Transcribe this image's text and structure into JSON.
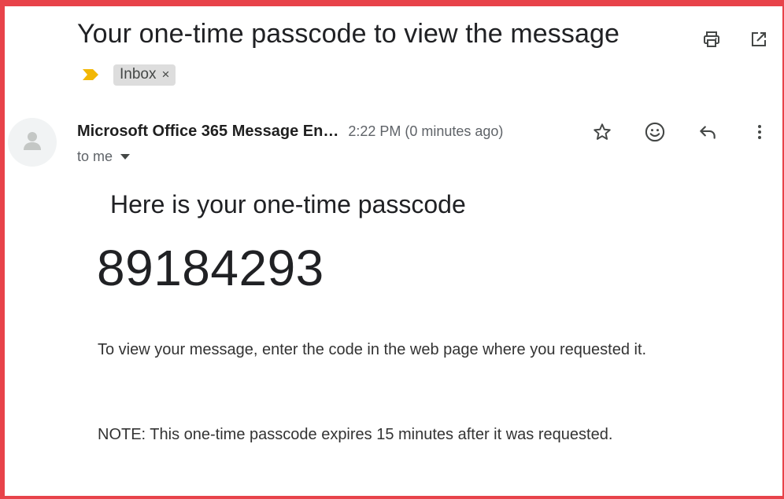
{
  "email": {
    "subject": "Your one-time passcode to view the message",
    "label": "Inbox",
    "label_remove": "×",
    "sender_name": "Microsoft Office 365 Message En…",
    "timestamp": "2:22 PM (0 minutes ago)",
    "recipient": "to me",
    "body": {
      "heading": "Here is your one-time passcode",
      "passcode": "89184293",
      "instruction": "To view your message, enter the code in the web page where you requested it.",
      "note": "NOTE: This one-time passcode expires 15 minutes after it was requested."
    }
  },
  "icons": {
    "print": "print-icon",
    "popout": "open-in-new-window-icon",
    "importance": "importance-marker-icon",
    "avatar": "person-icon",
    "star": "star-icon",
    "emoji": "emoji-reaction-icon",
    "reply": "reply-icon",
    "more": "more-vertical-icon"
  },
  "colors": {
    "frame_border": "#e8434a",
    "importance": "#f2b705",
    "label_chip_bg": "#dddddd",
    "secondary_text": "#5f6368"
  }
}
